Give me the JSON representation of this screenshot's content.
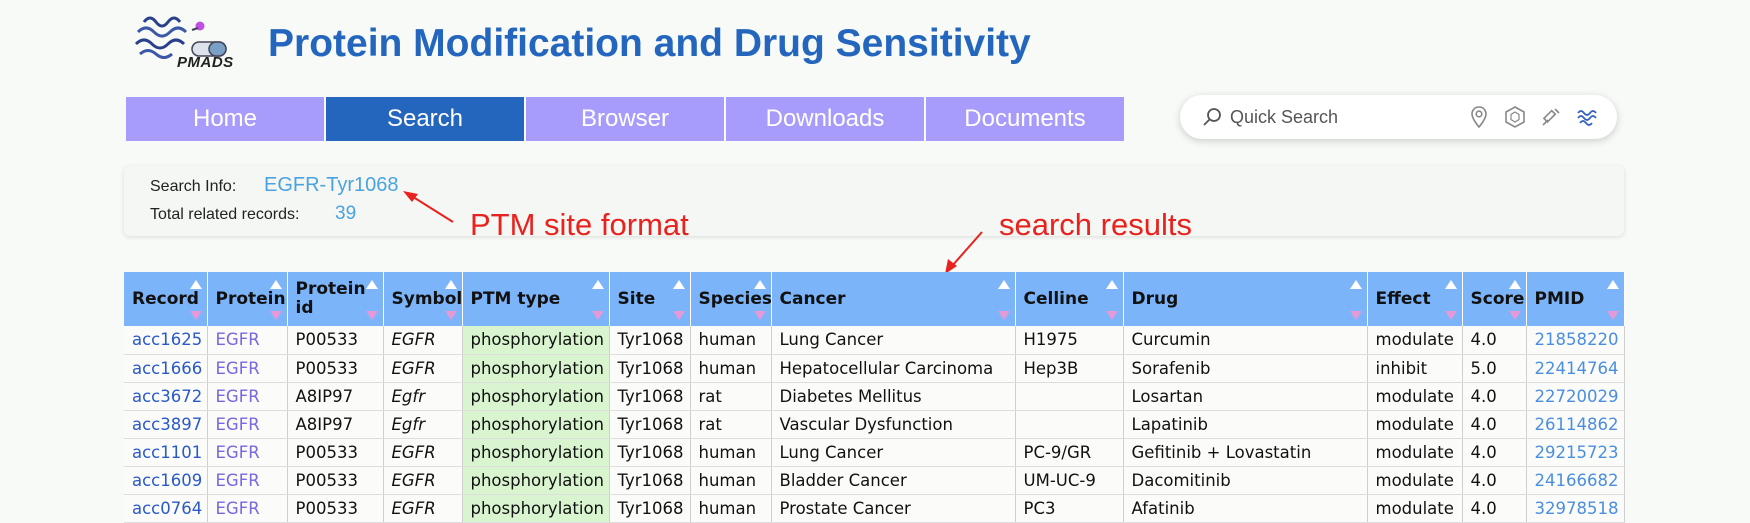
{
  "header": {
    "logo_text": "PMADS",
    "title": "Protein Modification and Drug Sensitivity"
  },
  "nav": {
    "tabs": [
      {
        "label": "Home",
        "active": false
      },
      {
        "label": "Search",
        "active": true
      },
      {
        "label": "Browser",
        "active": false
      },
      {
        "label": "Downloads",
        "active": false
      },
      {
        "label": "Documents",
        "active": false
      }
    ]
  },
  "quick_search": {
    "placeholder": "Quick Search",
    "tools": [
      "location-pin-icon",
      "hexagon-icon",
      "syringe-icon",
      "protein-structure-icon"
    ]
  },
  "search_info": {
    "info_label": "Search Info:",
    "info_value": "EGFR-Tyr1068",
    "total_label": "Total related records:",
    "total_value": "39"
  },
  "annotations": {
    "ptm_site": "PTM site format",
    "results": "search results"
  },
  "colors": {
    "brand": "#2466bd",
    "nav_tab": "#a79cfc",
    "table_header": "#7cb4fa",
    "ptm_cell": "#d9f5cf",
    "annotation": "#e8221e"
  },
  "table": {
    "columns": [
      "Record",
      "Protein",
      "Protein id",
      "Symbol",
      "PTM type",
      "Site",
      "Species",
      "Cancer",
      "Celline",
      "Drug",
      "Effect",
      "Score",
      "PMID"
    ],
    "rows": [
      [
        "acc1625",
        "EGFR",
        "P00533",
        "EGFR",
        "phosphorylation",
        "Tyr1068",
        "human",
        "Lung Cancer",
        "H1975",
        "Curcumin",
        "modulate",
        "4.0",
        "21858220"
      ],
      [
        "acc1666",
        "EGFR",
        "P00533",
        "EGFR",
        "phosphorylation",
        "Tyr1068",
        "human",
        "Hepatocellular Carcinoma",
        "Hep3B",
        "Sorafenib",
        "inhibit",
        "5.0",
        "22414764"
      ],
      [
        "acc3672",
        "EGFR",
        "A8IP97",
        "Egfr",
        "phosphorylation",
        "Tyr1068",
        "rat",
        "Diabetes Mellitus",
        "",
        "Losartan",
        "modulate",
        "4.0",
        "22720029"
      ],
      [
        "acc3897",
        "EGFR",
        "A8IP97",
        "Egfr",
        "phosphorylation",
        "Tyr1068",
        "rat",
        "Vascular Dysfunction",
        "",
        "Lapatinib",
        "modulate",
        "4.0",
        "26114862"
      ],
      [
        "acc1101",
        "EGFR",
        "P00533",
        "EGFR",
        "phosphorylation",
        "Tyr1068",
        "human",
        "Lung Cancer",
        "PC-9/GR",
        "Gefitinib + Lovastatin",
        "modulate",
        "4.0",
        "29215723"
      ],
      [
        "acc1609",
        "EGFR",
        "P00533",
        "EGFR",
        "phosphorylation",
        "Tyr1068",
        "human",
        "Bladder Cancer",
        "UM-UC-9",
        "Dacomitinib",
        "modulate",
        "4.0",
        "24166682"
      ],
      [
        "acc0764",
        "EGFR",
        "P00533",
        "EGFR",
        "phosphorylation",
        "Tyr1068",
        "human",
        "Prostate Cancer",
        "PC3",
        "Afatinib",
        "modulate",
        "4.0",
        "32978518"
      ]
    ]
  }
}
